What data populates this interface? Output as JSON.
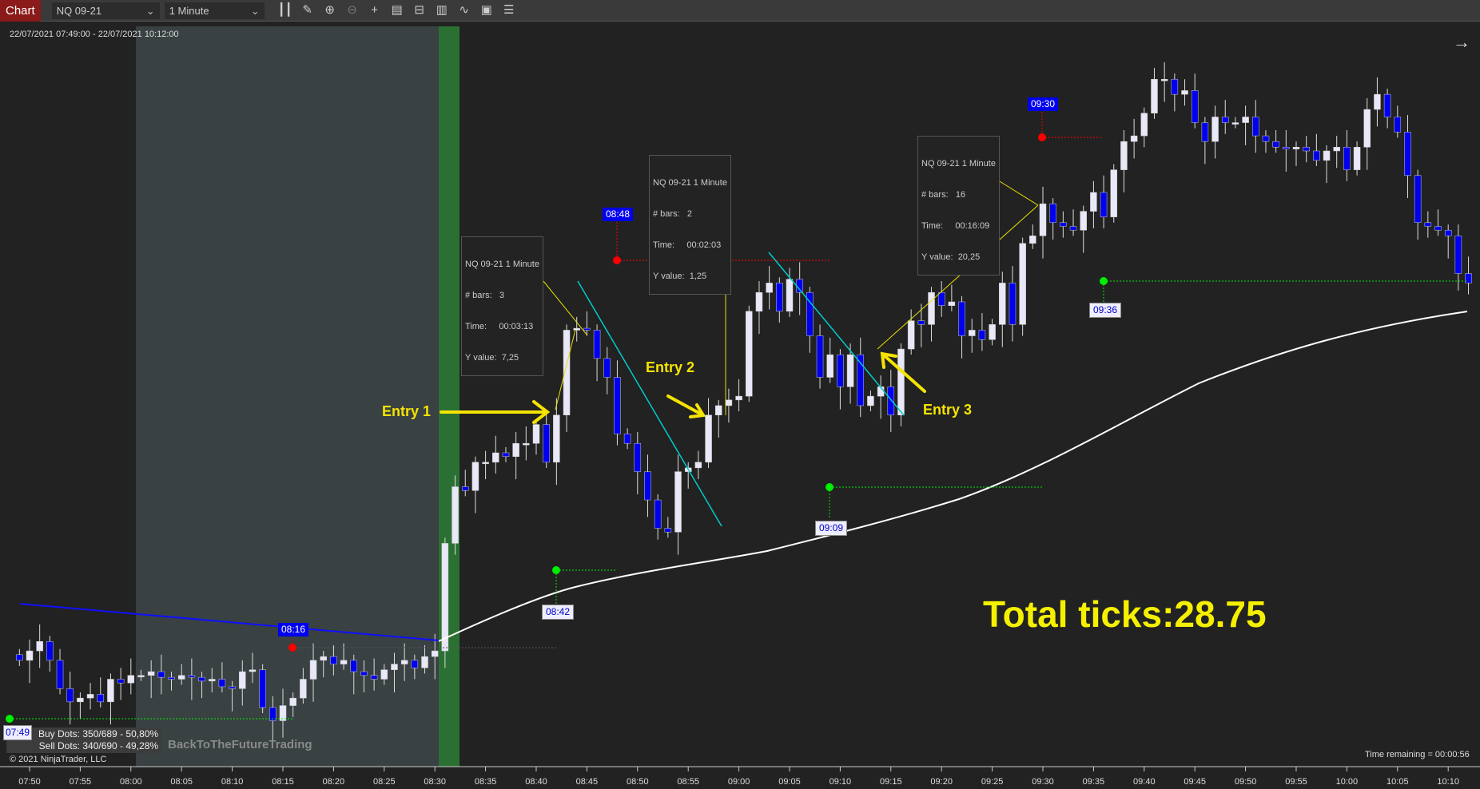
{
  "toolbar": {
    "chart_tab": "Chart",
    "instrument": "NQ 09-21",
    "interval": "1 Minute",
    "icons": [
      "bar-type-icon",
      "draw-pencil-icon",
      "zoom-in-icon",
      "zoom-out-icon",
      "crosshair-icon",
      "data-box-icon",
      "chart-trader-icon",
      "indicators-icon",
      "strategies-icon",
      "properties-icon",
      "object-list-icon"
    ]
  },
  "chart": {
    "date_range": "22/07/2021 07:49:00 - 22/07/2021 10:12:00",
    "tooltips": [
      {
        "title": "NQ 09-21 1 Minute",
        "bars_label": "# bars:",
        "bars": "3",
        "time_label": "Time:",
        "time": "00:03:13",
        "y_label": "Y value:",
        "y": "7,25"
      },
      {
        "title": "NQ 09-21 1 Minute",
        "bars_label": "# bars:",
        "bars": "2",
        "time_label": "Time:",
        "time": "00:02:03",
        "y_label": "Y value:",
        "y": "1,25"
      },
      {
        "title": "NQ 09-21 1 Minute",
        "bars_label": "# bars:",
        "bars": "16",
        "time_label": "Time:",
        "time": "00:16:09",
        "y_label": "Y value:",
        "y": "20,25"
      }
    ],
    "sell_markers": [
      "08:16",
      "08:48",
      "09:30"
    ],
    "buy_markers": [
      "07:49",
      "08:42",
      "09:09",
      "09:36"
    ],
    "entries": [
      "Entry 1",
      "Entry 2",
      "Entry 3"
    ],
    "total_ticks": "Total ticks:28.75",
    "buy_dots": "Buy Dots: 350/689 - 50,80%",
    "sell_dots": "Sell Dots: 340/690 - 49,28%",
    "watermark": "BackToTheFutureTrading",
    "copyright": "© 2021 NinjaTrader, LLC",
    "time_remaining": "Time remaining = 00:00:56",
    "colors": {
      "up": "#e8e8f8",
      "down": "#0000ee",
      "session_shade": "#394142",
      "open_band": "#2b7033",
      "sell_dot": "#ff0000",
      "buy_dot": "#00ee00",
      "entry": "#f5e400",
      "trend": "#00cccc",
      "sma": "#ffffff",
      "tab": "#8b1a1a"
    }
  },
  "chart_data": {
    "type": "candlestick",
    "instrument": "NQ 09-21",
    "interval": "1 Minute",
    "start": "07:49",
    "x_ticks": [
      "07:50",
      "07:55",
      "08:00",
      "08:05",
      "08:10",
      "08:15",
      "08:20",
      "08:25",
      "08:30",
      "08:35",
      "08:40",
      "08:45",
      "08:50",
      "08:55",
      "09:00",
      "09:05",
      "09:10",
      "09:15",
      "09:20",
      "09:25",
      "09:30",
      "09:35",
      "09:40",
      "09:45",
      "09:50",
      "09:55",
      "10:00",
      "10:05",
      "10:10"
    ],
    "closes": [
      14812.5,
      14813.75,
      14815,
      14812.5,
      14808.75,
      14807,
      14807.5,
      14808,
      14807,
      14810,
      14809.5,
      14810.5,
      14810.5,
      14811,
      14810.25,
      14810,
      14810.5,
      14810.25,
      14809.75,
      14810,
      14809,
      14808.75,
      14811,
      14811.25,
      14806.25,
      14804.5,
      14806.5,
      14807.5,
      14810,
      14812.5,
      14813,
      14812,
      14812.5,
      14811,
      14810.5,
      14810,
      14811.25,
      14812,
      14812.5,
      14811.5,
      14813,
      14813.75,
      14828,
      14835.5,
      14835,
      14838.75,
      14838.75,
      14840,
      14839.5,
      14841.25,
      14841.25,
      14843.75,
      14838.75,
      14845,
      14856.25,
      14856.5,
      14856.25,
      14852.5,
      14850,
      14842.5,
      14841.25,
      14837.5,
      14833.75,
      14830,
      14829.5,
      14837.5,
      14838,
      14838.75,
      14845,
      14846.25,
      14847,
      14847.5,
      14858.75,
      14861.25,
      14862.5,
      14858.75,
      14863,
      14861.25,
      14855.5,
      14850,
      14853,
      14848.75,
      14853,
      14846.25,
      14847.5,
      14848.75,
      14845,
      14853.75,
      14857.5,
      14857,
      14861.25,
      14859.5,
      14860,
      14855.5,
      14856.25,
      14855,
      14857,
      14862.5,
      14857,
      14867.75,
      14868.75,
      14873,
      14870.5,
      14870,
      14869.5,
      14872,
      14874.5,
      14871.25,
      14877.5,
      14881.25,
      14882,
      14885,
      14889.5,
      14889.5,
      14887.5,
      14888,
      14883.75,
      14881.25,
      14884.5,
      14883.75,
      14883.75,
      14884.5,
      14882,
      14881.25,
      14880.5,
      14880.25,
      14880.5,
      14880,
      14878.75,
      14880,
      14880.5,
      14877.5,
      14880.5,
      14885.5,
      14887.5,
      14884.5,
      14882.5,
      14876.75,
      14870.5,
      14870,
      14869.5,
      14868.75,
      14863.75,
      14862.5
    ]
  }
}
